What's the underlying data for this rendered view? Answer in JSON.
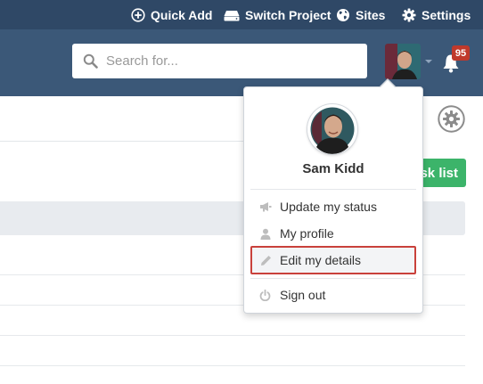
{
  "topbar": {
    "quick_add": "Quick Add",
    "switch_project": "Switch Project",
    "sites": "Sites",
    "settings": "Settings"
  },
  "search": {
    "placeholder": "Search for..."
  },
  "notifications": {
    "count": "95"
  },
  "page": {
    "task_list_button": "sk list"
  },
  "user_menu": {
    "name": "Sam Kidd",
    "items": [
      {
        "label": "Update my status",
        "icon": "megaphone-icon"
      },
      {
        "label": "My profile",
        "icon": "user-icon"
      },
      {
        "label": "Edit my details",
        "icon": "pencil-icon",
        "highlighted": true
      },
      {
        "label": "Sign out",
        "icon": "power-icon"
      }
    ]
  },
  "colors": {
    "topbar": "#2f4866",
    "header": "#3b5878",
    "badge": "#c0392b",
    "task_button": "#3cb46a",
    "highlight_border": "#c9413b"
  }
}
